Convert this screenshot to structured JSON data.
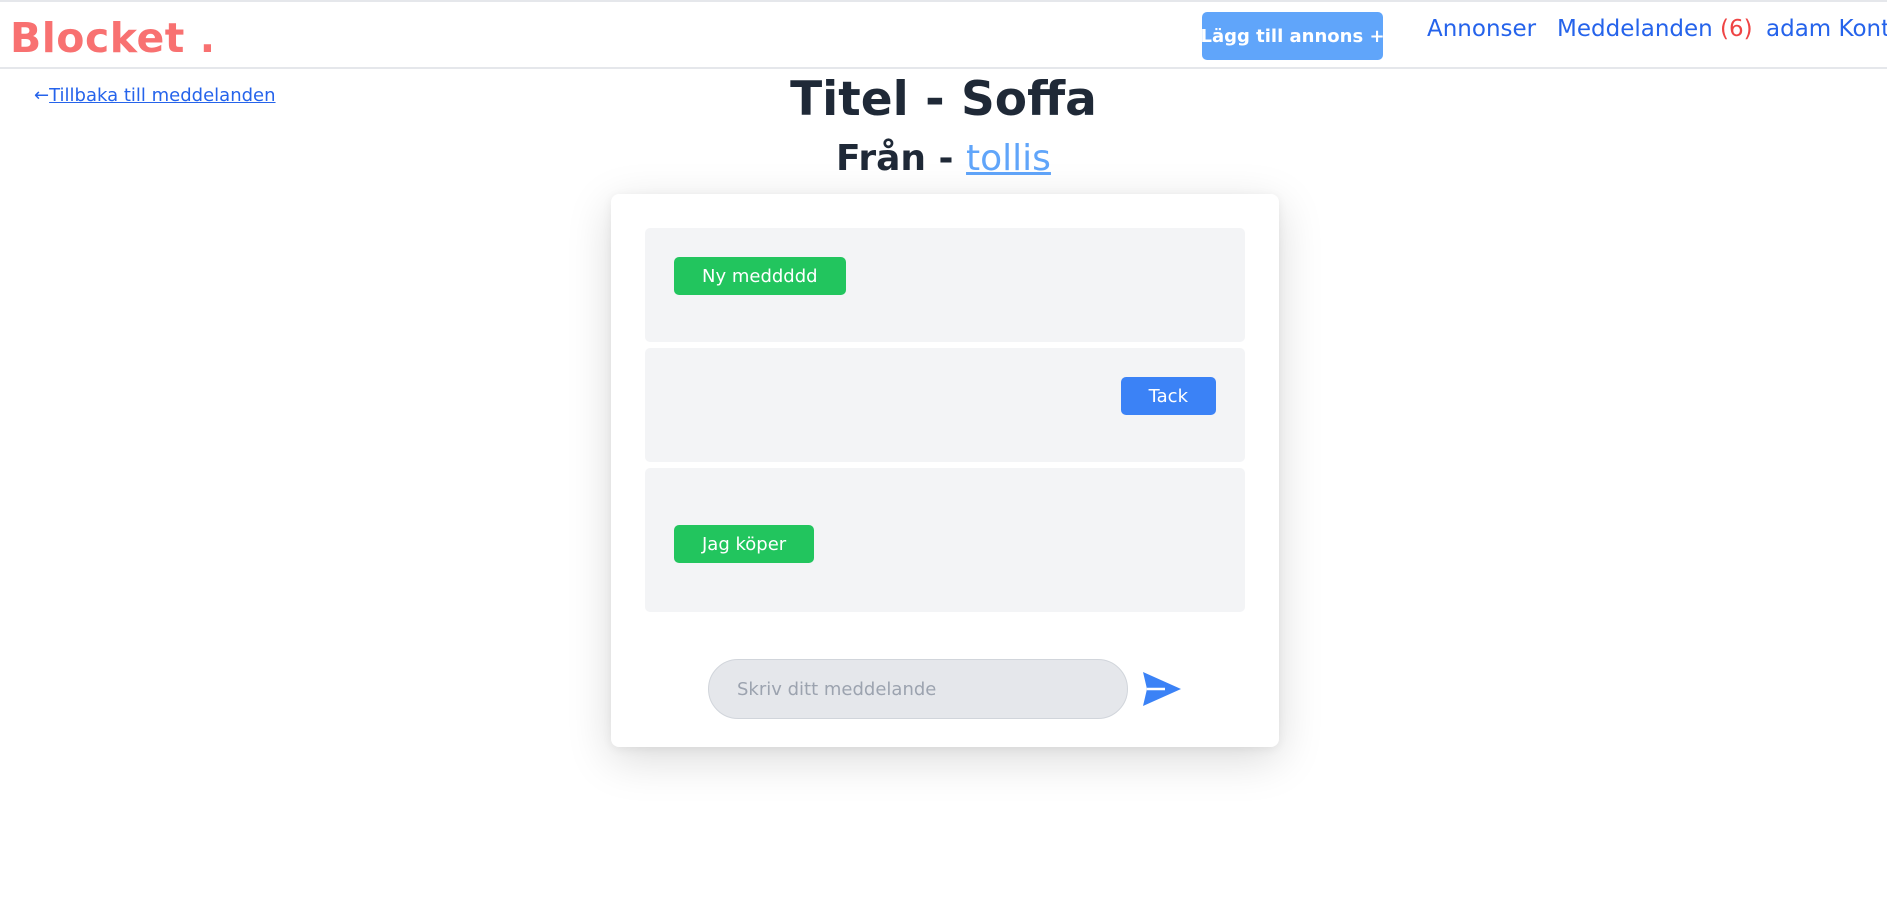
{
  "header": {
    "logo": "Blocket .",
    "add_button": "Lägg till annons +",
    "nav": {
      "ads": "Annonser",
      "messages": "Meddelanden",
      "messages_count": "(6)",
      "account": "adam Konto"
    }
  },
  "back_link": {
    "arrow": "←",
    "label": "Tillbaka till meddelanden"
  },
  "conversation": {
    "title": "Titel - Soffa",
    "from_prefix": "Från - ",
    "from_user": "tollis"
  },
  "messages": [
    {
      "text": "Ny meddddd",
      "side": "left",
      "color": "#22c55e"
    },
    {
      "text": "Tack",
      "side": "right",
      "color": "#3b82f6"
    },
    {
      "text": "Jag köper",
      "side": "left",
      "color": "#22c55e"
    }
  ],
  "compose": {
    "placeholder": "Skriv ditt meddelande",
    "send_icon": "paper-plane-icon"
  },
  "colors": {
    "brand": "#f87171",
    "link": "#2563eb",
    "primary_button": "#60a5fa",
    "incoming_bubble": "#22c55e",
    "outgoing_bubble": "#3b82f6",
    "badge": "#ef4444"
  }
}
